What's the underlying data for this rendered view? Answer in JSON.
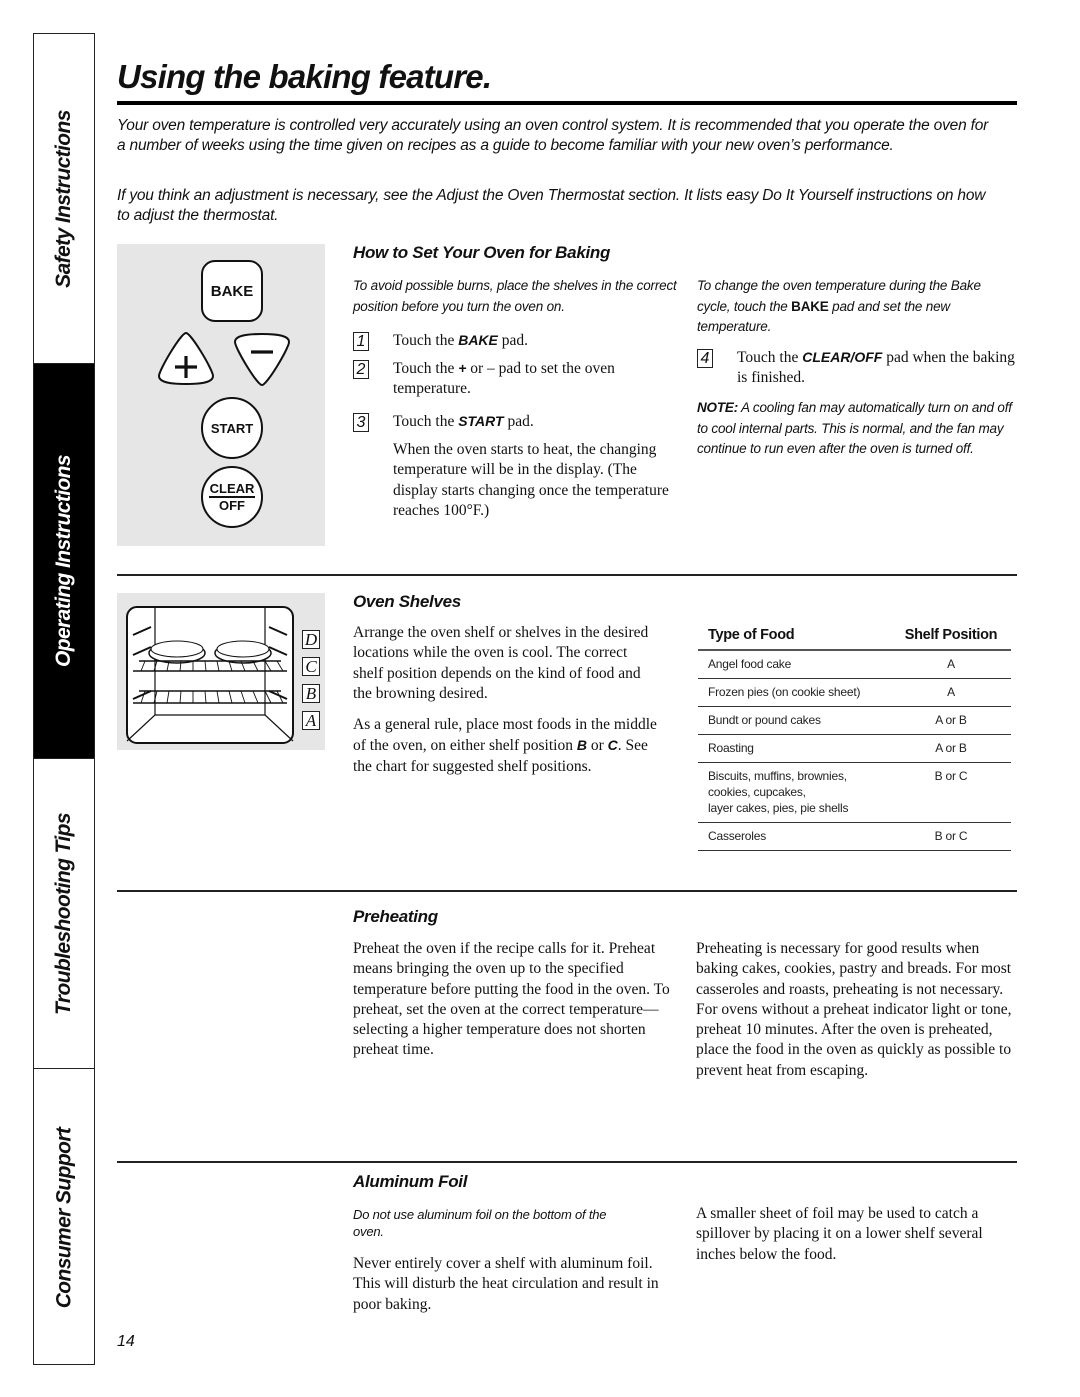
{
  "side_tabs": [
    {
      "label": "Safety Instructions",
      "active": false
    },
    {
      "label": "Operating Instructions",
      "active": true
    },
    {
      "label": "Troubleshooting Tips",
      "active": false
    },
    {
      "label": "Consumer Support",
      "active": false
    }
  ],
  "title": "Using the baking feature.",
  "intro": [
    "Your oven temperature is controlled very accurately using an oven control system. It is recommended that you operate the oven for a number of weeks using the time given on recipes as a guide to become familiar with your new oven’s performance.",
    "If you think an adjustment is necessary, see the Adjust the Oven Thermostat section. It lists easy Do It Yourself instructions on how to adjust the thermostat."
  ],
  "control_panel": {
    "bake": "BAKE",
    "plus": "+",
    "minus": "–",
    "start": "START",
    "clear": "CLEAR",
    "off": "OFF"
  },
  "how_to_set": {
    "heading": "How to Set Your Oven for Baking",
    "caution": "To avoid possible burns, place the shelves in the correct position before you turn the oven on.",
    "steps": [
      {
        "num": "1",
        "pre": "Touch the ",
        "bold": "BAKE",
        "post": " pad."
      },
      {
        "num": "2",
        "pre": "Touch the ",
        "bold": "+",
        "post": " or – pad to set the oven temperature."
      },
      {
        "num": "3",
        "pre": "Touch the ",
        "bold": "START",
        "post": " pad."
      }
    ],
    "step3_note": "When the oven starts to heat, the changing temperature will be in the display. (The display starts changing once the temperature reaches 100°F.)",
    "change_temp_pre": "To change the oven temperature during the Bake cycle, touch the ",
    "change_temp_bold": "BAKE",
    "change_temp_post": " pad and set the new temperature.",
    "step4": {
      "num": "4",
      "pre": "Touch the ",
      "bold": "CLEAR/OFF",
      "post": " pad when the baking is finished."
    },
    "note_label": "NOTE:",
    "note_text": " A cooling fan may automatically turn on and off to cool internal parts. This is normal, and the fan may continue to run even after the oven is turned off."
  },
  "oven_shelves": {
    "heading": "Oven Shelves",
    "shelf_letters": [
      "D",
      "C",
      "B",
      "A"
    ],
    "para1": "Arrange the oven shelf or shelves in the desired locations while the oven is cool. The correct shelf position depends on the kind of food and the browning desired.",
    "para2_pre": "As a general rule, place most foods in the middle of the oven, on either shelf position ",
    "para2_b1": "B",
    "para2_mid": " or ",
    "para2_b2": "C",
    "para2_post": ". See the chart for suggested shelf positions.",
    "table": {
      "headers": [
        "Type of Food",
        "Shelf Position"
      ],
      "rows": [
        {
          "food": "Angel food cake",
          "position": "A"
        },
        {
          "food": "Frozen pies (on cookie sheet)",
          "position": "A"
        },
        {
          "food": "Bundt or pound cakes",
          "position": "A or B"
        },
        {
          "food": "Roasting",
          "position": "A or B"
        },
        {
          "food": "Biscuits, muffins, brownies,\ncookies, cupcakes,\nlayer cakes, pies, pie shells",
          "position": "B or C"
        },
        {
          "food": "Casseroles",
          "position": "B or C"
        }
      ]
    }
  },
  "preheating": {
    "heading": "Preheating",
    "col1": "Preheat the oven if the recipe calls for it. Preheat means bringing the oven up to the specified temperature before putting the food in the oven. To preheat, set the oven at the correct temperature—selecting a higher temperature does not shorten preheat time.",
    "col2": "Preheating is necessary for good results when baking cakes, cookies, pastry and breads. For most casseroles and roasts, preheating is not necessary. For ovens without a preheat indicator light or tone, preheat 10 minutes. After the oven is preheated, place the food in the oven as quickly as possible to prevent heat from escaping."
  },
  "aluminum_foil": {
    "heading": "Aluminum Foil",
    "caution": "Do not use aluminum foil on the bottom of the oven.",
    "col1": "Never entirely cover a shelf with aluminum foil. This will disturb the heat circulation and result in poor baking.",
    "col2": "A smaller sheet of foil may be used to catch a spillover by placing it on a lower shelf several inches below the food."
  },
  "page_number": "14"
}
